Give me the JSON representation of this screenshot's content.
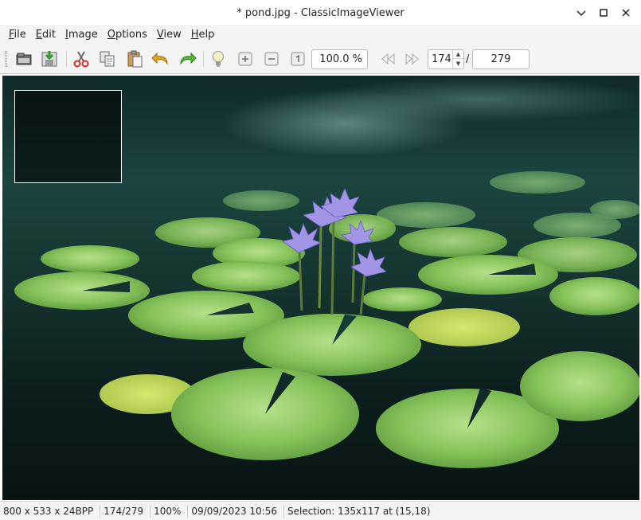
{
  "window": {
    "title": "* pond.jpg - ClassicImageViewer"
  },
  "menu": [
    {
      "label": "File",
      "accel": "F",
      "rest": "ile"
    },
    {
      "label": "Edit",
      "accel": "E",
      "rest": "dit"
    },
    {
      "label": "Image",
      "accel": "I",
      "rest": "mage"
    },
    {
      "label": "Options",
      "accel": "O",
      "rest": "ptions"
    },
    {
      "label": "View",
      "accel": "V",
      "rest": "iew"
    },
    {
      "label": "Help",
      "accel": "H",
      "rest": "elp"
    }
  ],
  "toolbar": {
    "icons": [
      "open-icon",
      "save-icon",
      "cut-icon",
      "copy-icon",
      "paste-icon",
      "undo-icon",
      "redo-icon",
      "lightbulb-icon",
      "zoom-in-icon",
      "zoom-out-icon",
      "original-size-icon",
      "previous-icon",
      "next-icon"
    ],
    "zoom_value": "100.0 %",
    "page_value": "174",
    "separator": "/",
    "total_pages": "279"
  },
  "canvas": {
    "image": "pond-water-lilies",
    "selection_visible": true
  },
  "status": {
    "dimensions": "800 x 533 x 24BPP",
    "position": "174/279",
    "zoom": "100%",
    "datetime": "09/09/2023 10:56",
    "selection": "Selection: 135x117 at (15,18)"
  },
  "colors": {
    "background": "#f4f4f4",
    "text": "#232627",
    "pad_green": "#8cc760",
    "flower": "#9a8fe0"
  }
}
